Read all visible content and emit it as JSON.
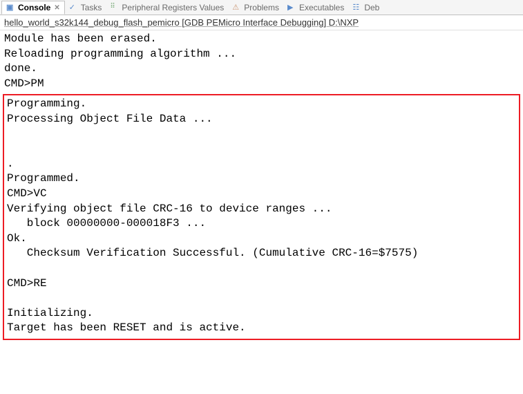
{
  "tabs": {
    "console": {
      "label": "Console",
      "active": true
    },
    "tasks": {
      "label": "Tasks"
    },
    "registers": {
      "label": "Peripheral Registers Values"
    },
    "problems": {
      "label": "Problems"
    },
    "executables": {
      "label": "Executables"
    },
    "debug": {
      "label": "Deb"
    }
  },
  "subtitle": "hello_world_s32k144_debug_flash_pemicro [GDB PEMicro Interface Debugging] D:\\NXP",
  "console": {
    "pre": "Module has been erased.\nReloading programming algorithm ...\ndone.\nCMD>PM",
    "highlight": "Programming.\nProcessing Object File Data ...\n\n\n.\nProgrammed.\nCMD>VC\nVerifying object file CRC-16 to device ranges ...\n   block 00000000-000018F3 ...\nOk.\n   Checksum Verification Successful. (Cumulative CRC-16=$7575)\n\nCMD>RE\n\nInitializing.\nTarget has been RESET and is active."
  }
}
